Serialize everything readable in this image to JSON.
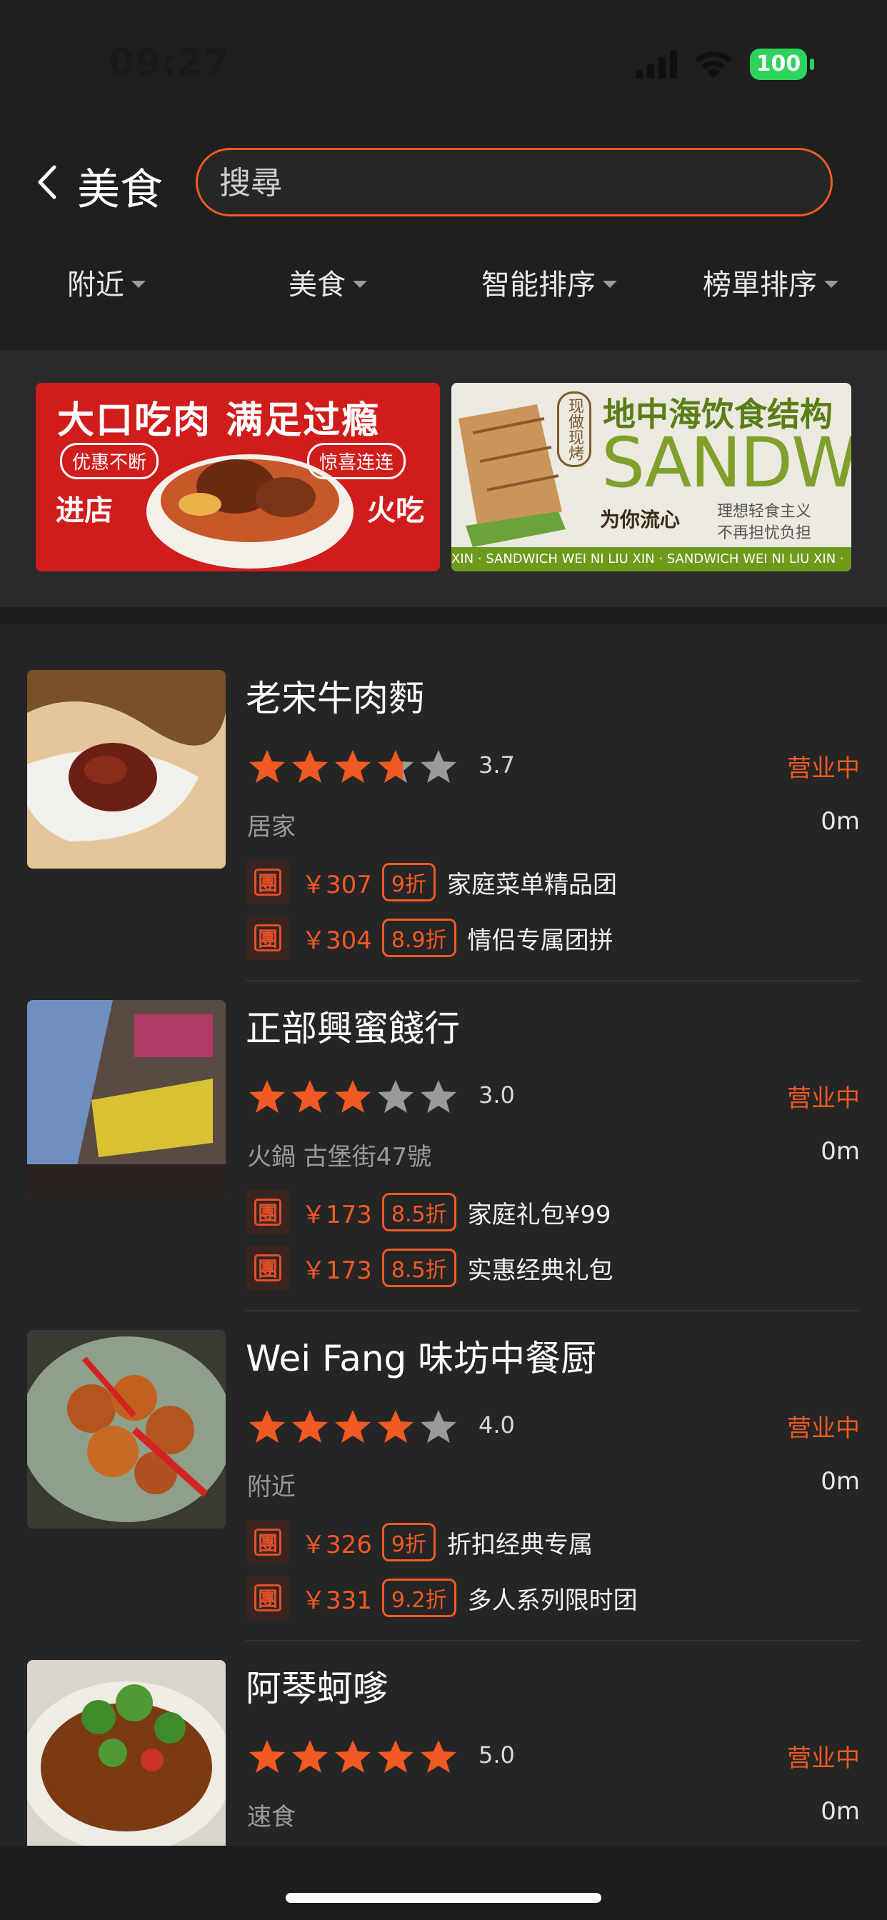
{
  "status_bar": {
    "time": "09:27",
    "battery": "100"
  },
  "header": {
    "title": "美食",
    "search_placeholder": "搜尋"
  },
  "filters": [
    "附近",
    "美食",
    "智能排序",
    "榜單排序"
  ],
  "banners": [
    {
      "headline": "大口吃肉 满足过瘾",
      "tag_left": "优惠不断",
      "tag_right": "惊喜连连",
      "sub_left": "进店",
      "sub_right": "火吃"
    },
    {
      "stamp": "现做现烤",
      "headline": "地中海饮食结构",
      "big": "SANDWIC",
      "brand": "为你流心",
      "slogan1": "理想轻食主义",
      "slogan2": "不再担忧负担",
      "band": "XIN · SANDWICH     WEI NI LIU XIN · SANDWICH     WEI NI LIU XIN ·"
    }
  ],
  "shops": [
    {
      "name": "老宋牛肉麪",
      "rating": "3.7",
      "rating_value": 3.7,
      "status": "营业中",
      "category": "居家",
      "distance": "0m",
      "deals": [
        {
          "price": "￥307",
          "discount": "9折",
          "title": "家庭菜单精品团"
        },
        {
          "price": "￥304",
          "discount": "8.9折",
          "title": "情侣专属团拼"
        }
      ]
    },
    {
      "name": "正部興蜜餞行",
      "rating": "3.0",
      "rating_value": 3.0,
      "status": "营业中",
      "category": "火鍋  古堡街47號",
      "distance": "0m",
      "deals": [
        {
          "price": "￥173",
          "discount": "8.5折",
          "title": "家庭礼包¥99"
        },
        {
          "price": "￥173",
          "discount": "8.5折",
          "title": "实惠经典礼包"
        }
      ]
    },
    {
      "name": "Wei Fang 味坊中餐厨",
      "rating": "4.0",
      "rating_value": 4.0,
      "status": "营业中",
      "category": "附近",
      "distance": "0m",
      "deals": [
        {
          "price": "￥326",
          "discount": "9折",
          "title": "折扣经典专属"
        },
        {
          "price": "￥331",
          "discount": "9.2折",
          "title": "多人系列限时团"
        }
      ]
    },
    {
      "name": "阿琴蚵嗲",
      "rating": "5.0",
      "rating_value": 5.0,
      "status": "营业中",
      "category": "速食",
      "distance": "0m",
      "deals": []
    }
  ],
  "deal_icon_char": "團",
  "colors": {
    "accent": "#f15a22",
    "star_gray": "#9a9a9a",
    "background": "#252525"
  }
}
